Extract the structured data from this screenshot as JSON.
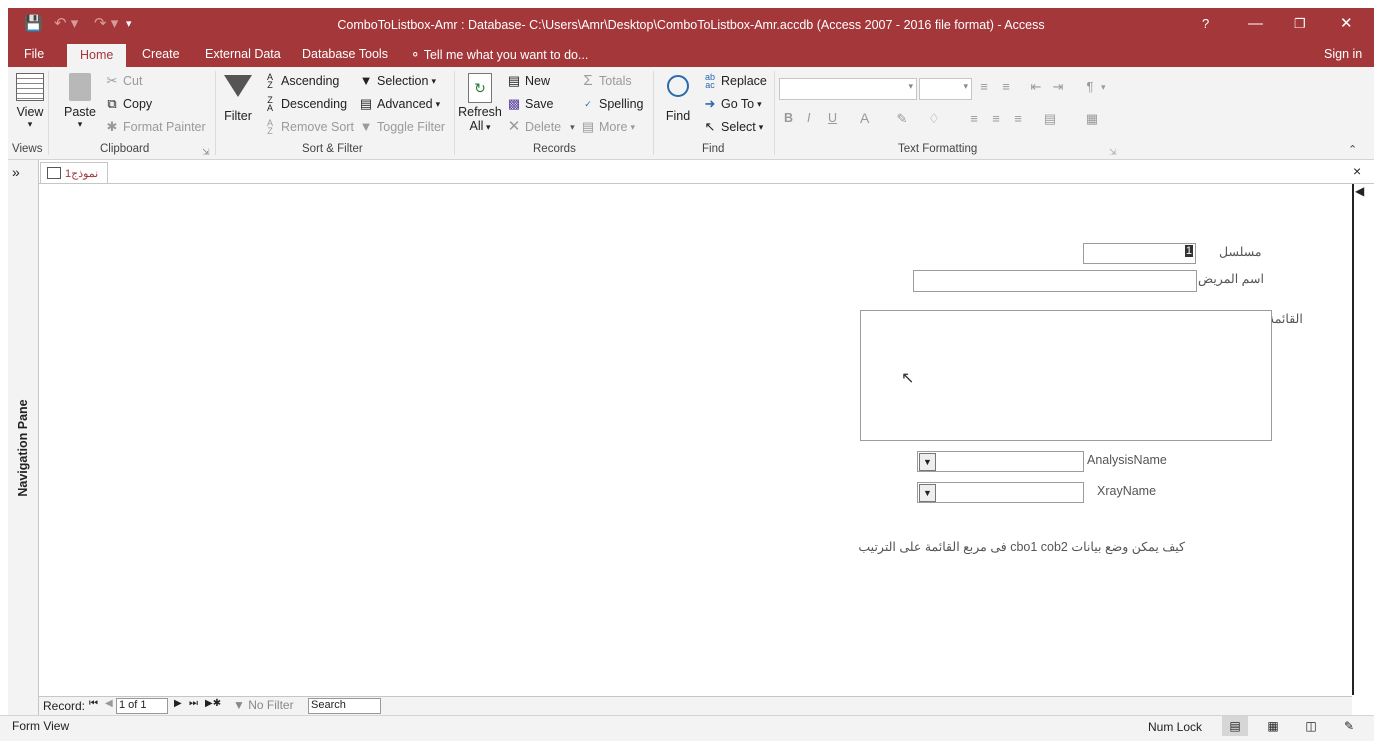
{
  "window": {
    "title": "ComboToListbox-Amr : Database- C:\\Users\\Amr\\Desktop\\ComboToListbox-Amr.accdb (Access 2007 - 2016 file format) - Access",
    "help": "?"
  },
  "menu": {
    "tabs": [
      "File",
      "Home",
      "Create",
      "External Data",
      "Database Tools"
    ],
    "tell_me": "Tell me what you want to do...",
    "sign_in": "Sign in"
  },
  "ribbon": {
    "views": {
      "view": "View",
      "label": "Views"
    },
    "clipboard": {
      "paste": "Paste",
      "cut": "Cut",
      "copy": "Copy",
      "format_painter": "Format Painter",
      "label": "Clipboard"
    },
    "sort_filter": {
      "filter": "Filter",
      "ascending": "Ascending",
      "descending": "Descending",
      "remove_sort": "Remove Sort",
      "selection": "Selection",
      "advanced": "Advanced",
      "toggle_filter": "Toggle Filter",
      "label": "Sort & Filter"
    },
    "records": {
      "refresh": "Refresh",
      "refresh_all": "All",
      "new": "New",
      "save": "Save",
      "delete": "Delete",
      "totals": "Totals",
      "spelling": "Spelling",
      "more": "More",
      "label": "Records"
    },
    "find": {
      "find": "Find",
      "replace": "Replace",
      "goto": "Go To",
      "select": "Select",
      "label": "Find"
    },
    "text_formatting": {
      "bold": "B",
      "italic": "I",
      "underline": "U",
      "font_color": "A",
      "label": "Text Formatting"
    }
  },
  "document": {
    "tab_label": "نموذج1",
    "nav_pane": "Navigation Pane",
    "nav_toggle": "»",
    "close": "×"
  },
  "form": {
    "serial_label": "مسلسل",
    "serial_value": "1",
    "patient_label": "اسم المريض",
    "list_label": "القائمة",
    "analysis_label": "AnalysisName",
    "xray_label": "XrayName",
    "note": "كيف يمكن وضع بيانات cbo1 cob2  فى مربع القائمة على الترتيب"
  },
  "record_nav": {
    "record_label": "Record:",
    "position": "1 of 1",
    "no_filter": "No Filter",
    "search": "Search"
  },
  "status": {
    "view": "Form View",
    "num_lock": "Num Lock"
  },
  "colors": {
    "accent": "#a4373a",
    "ribbon_bg": "#f3f3f3"
  }
}
